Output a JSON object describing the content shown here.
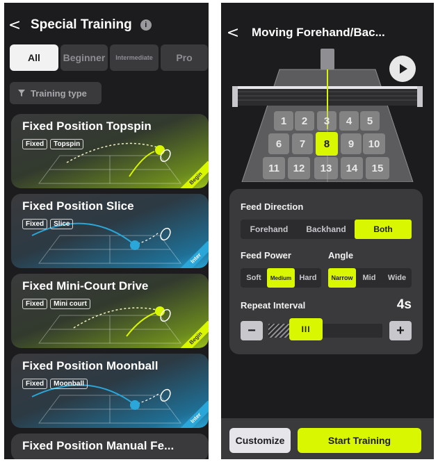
{
  "left": {
    "header": {
      "back_glyph": "<",
      "title": "Special Training",
      "info_icon": "i"
    },
    "tabs": [
      {
        "label": "All",
        "active": true
      },
      {
        "label": "Beginner",
        "active": false
      },
      {
        "label": "Intermediate",
        "active": false
      },
      {
        "label": "Pro",
        "active": false
      }
    ],
    "filter_label": "Training type",
    "cards": [
      {
        "title": "Fixed Position Topspin",
        "chips": [
          "Fixed",
          "Topspin"
        ],
        "corner": "Begin",
        "theme": "green"
      },
      {
        "title": "Fixed Position Slice",
        "chips": [
          "Fixed",
          "Slice"
        ],
        "corner": "Inter",
        "theme": "blue"
      },
      {
        "title": "Fixed Mini-Court Drive",
        "chips": [
          "Fixed",
          "Mini court"
        ],
        "corner": "Begin",
        "theme": "green"
      },
      {
        "title": "Fixed Position Moonball",
        "chips": [
          "Fixed",
          "Moonball"
        ],
        "corner": "Inter",
        "theme": "blue"
      },
      {
        "title": "Fixed Position Manual Fe..."
      }
    ]
  },
  "right": {
    "header": {
      "back_glyph": "<",
      "title": "Moving Forehand/Bac..."
    },
    "zones": [
      "1",
      "2",
      "3",
      "4",
      "5",
      "6",
      "7",
      "8",
      "9",
      "10",
      "11",
      "12",
      "13",
      "14",
      "15"
    ],
    "selected_zone": "8",
    "feed_direction": {
      "label": "Feed Direction",
      "options": [
        "Forehand",
        "Backhand",
        "Both"
      ],
      "selected": "Both"
    },
    "feed_power": {
      "label": "Feed Power",
      "options": [
        "Soft",
        "Medium",
        "Hard"
      ],
      "selected": "Medium"
    },
    "angle": {
      "label": "Angle",
      "options": [
        "Narrow",
        "Mid",
        "Wide"
      ],
      "selected": "Narrow"
    },
    "repeat_interval": {
      "label": "Repeat Interval",
      "value": "4s",
      "minus": "−",
      "plus": "+",
      "handle": "III",
      "level": 0.33
    },
    "buttons": {
      "customize": "Customize",
      "start": "Start Training"
    }
  },
  "colors": {
    "accent": "#d9f700",
    "blue": "#2aa6d8",
    "bg": "#1c1c1e",
    "panel": "#3a3a3c"
  }
}
